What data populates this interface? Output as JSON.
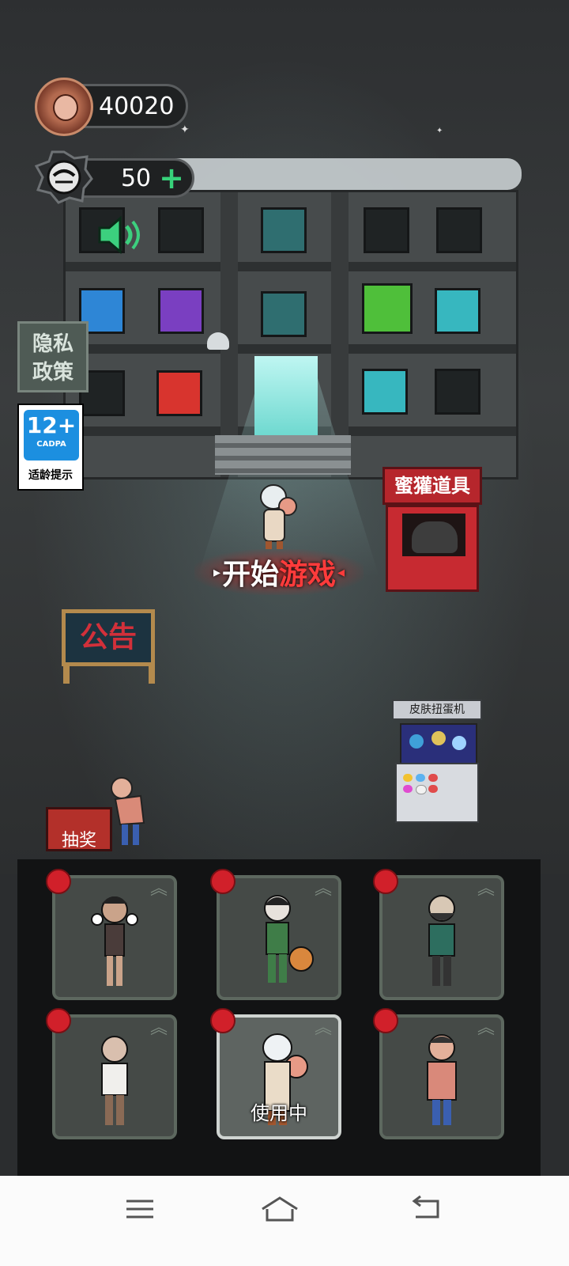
{
  "hud": {
    "coins": "40020",
    "energy": "50",
    "energy_add": "+"
  },
  "left_menu": {
    "privacy_line1": "隐私",
    "privacy_line2": "政策",
    "age_rating": "12+",
    "age_org": "CADPA",
    "age_tip": "适龄提示"
  },
  "shop": {
    "label": "蜜獾道具"
  },
  "start": {
    "part1": "开始",
    "part2": "游戏"
  },
  "notice": {
    "label": "公告"
  },
  "gacha": {
    "label": "皮肤扭蛋机"
  },
  "lottery": {
    "label": "抽奖"
  },
  "characters": {
    "in_use_label": "使用中",
    "slots": [
      {
        "name": "girl-with-bows",
        "active": false
      },
      {
        "name": "basketball-boy",
        "active": false
      },
      {
        "name": "bearded-man",
        "active": false
      },
      {
        "name": "grandpa-glasses",
        "active": false
      },
      {
        "name": "grandma-fan",
        "active": true
      },
      {
        "name": "woman-glasses",
        "active": false
      }
    ]
  },
  "colors": {
    "accent_red": "#d1202a",
    "plus_green": "#37d27a",
    "card_border": "#5d685f"
  }
}
